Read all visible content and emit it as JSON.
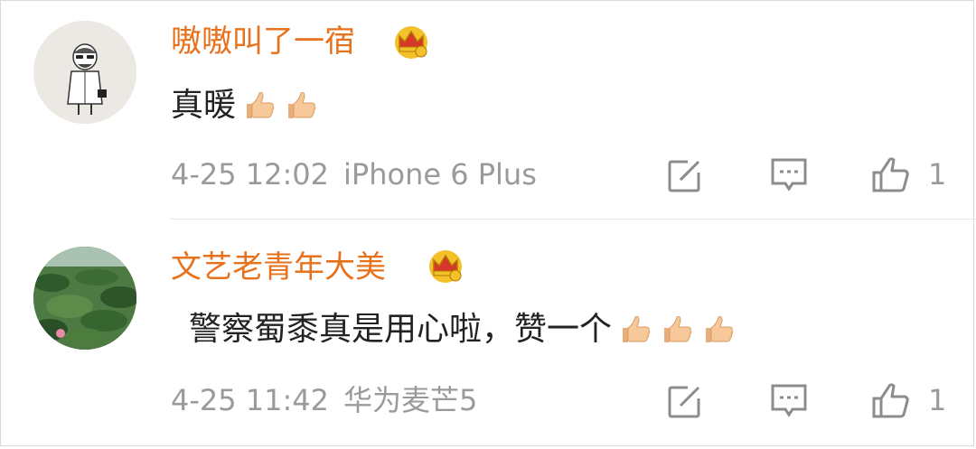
{
  "comments": [
    {
      "username": "嗷嗷叫了一宿",
      "text": "真暖",
      "thumbs_count": 2,
      "time": "4-25 12:02",
      "device": "iPhone 6 Plus",
      "likes": "1",
      "avatar": "cartoon-man-avatar",
      "badge": "crown-icon"
    },
    {
      "username": "文艺老青年大美",
      "text": "警察蜀黍真是用心啦，赞一个",
      "thumbs_count": 3,
      "time": "4-25 11:42",
      "device": "华为麦芒5",
      "likes": "1",
      "avatar": "lotus-pond-avatar",
      "badge": "crown-icon"
    }
  ],
  "colors": {
    "username": "#e8711c",
    "meta": "#9a9a9a",
    "text": "#222222",
    "divider": "#e6e6e6",
    "icon": "#8c8c8c",
    "crown_gold": "#f5c12a",
    "crown_red": "#d9362b",
    "thumb": "#f6c89a"
  }
}
